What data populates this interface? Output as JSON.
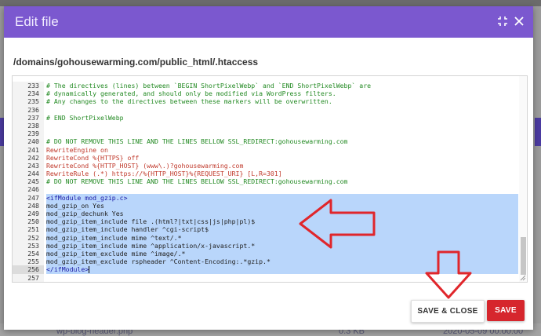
{
  "background": {
    "file_name": "wp-blog-header.php",
    "file_size": "0.3 KB",
    "file_date": "2020-05-09 00:00:00"
  },
  "modal": {
    "title": "Edit file",
    "file_path": "/domains/gohousewarming.com/public_html/.htaccess",
    "icons": [
      "expand-icon",
      "close-icon"
    ]
  },
  "editor": {
    "lines": [
      {
        "num": "233",
        "text": "# The directives (lines) between `BEGIN ShortPixelWebp` and `END ShortPixelWebp` are",
        "style": "comment",
        "selected": false
      },
      {
        "num": "234",
        "text": "# dynamically generated, and should only be modified via WordPress filters.",
        "style": "comment",
        "selected": false
      },
      {
        "num": "235",
        "text": "# Any changes to the directives between these markers will be overwritten.",
        "style": "comment",
        "selected": false
      },
      {
        "num": "236",
        "text": "",
        "style": "plain",
        "selected": false
      },
      {
        "num": "237",
        "text": "# END ShortPixelWebp",
        "style": "comment",
        "selected": false
      },
      {
        "num": "238",
        "text": "",
        "style": "plain",
        "selected": false
      },
      {
        "num": "239",
        "text": "",
        "style": "plain",
        "selected": false
      },
      {
        "num": "240",
        "text": "# DO NOT REMOVE THIS LINE AND THE LINES BELLOW SSL_REDIRECT:gohousewarming.com",
        "style": "comment",
        "selected": false
      },
      {
        "num": "241",
        "text": "RewriteEngine on",
        "style": "directive",
        "selected": false
      },
      {
        "num": "242",
        "text": "RewriteCond %{HTTPS} off",
        "style": "directive",
        "selected": false
      },
      {
        "num": "243",
        "text": "RewriteCond %{HTTP_HOST} (www\\.)?gohousewarming.com",
        "style": "directive",
        "selected": false
      },
      {
        "num": "244",
        "text": "RewriteRule (.*) https://%{HTTP_HOST}%{REQUEST_URI} [L,R=301]",
        "style": "directive",
        "selected": false
      },
      {
        "num": "245",
        "text": "# DO NOT REMOVE THIS LINE AND THE LINES BELLOW SSL_REDIRECT:gohousewarming.com",
        "style": "comment",
        "selected": false
      },
      {
        "num": "246",
        "text": "",
        "style": "plain",
        "selected": false
      },
      {
        "num": "247",
        "text": "<ifModule mod_gzip.c>",
        "style": "tag",
        "selected": true
      },
      {
        "num": "248",
        "text": "mod_gzip_on Yes",
        "style": "plain",
        "selected": true
      },
      {
        "num": "249",
        "text": "mod_gzip_dechunk Yes",
        "style": "plain",
        "selected": true
      },
      {
        "num": "250",
        "text": "mod_gzip_item_include file .(html?|txt|css|js|php|pl)$",
        "style": "plain",
        "selected": true
      },
      {
        "num": "251",
        "text": "mod_gzip_item_include handler ^cgi-script$",
        "style": "plain",
        "selected": true
      },
      {
        "num": "252",
        "text": "mod_gzip_item_include mime ^text/.*",
        "style": "plain",
        "selected": true
      },
      {
        "num": "253",
        "text": "mod_gzip_item_include mime ^application/x-javascript.*",
        "style": "plain",
        "selected": true
      },
      {
        "num": "254",
        "text": "mod_gzip_item_exclude mime ^image/.*",
        "style": "plain",
        "selected": true
      },
      {
        "num": "255",
        "text": "mod_gzip_item_exclude rspheader ^Content-Encoding:.*gzip.*",
        "style": "plain",
        "selected": true
      },
      {
        "num": "256",
        "text": "</ifModule>",
        "style": "tag",
        "selected": true
      },
      {
        "num": "257",
        "text": "",
        "style": "plain",
        "selected": false
      }
    ],
    "active_line": "256"
  },
  "buttons": {
    "save_close": "SAVE & CLOSE",
    "save": "SAVE"
  },
  "colors": {
    "header": "#7b58cf",
    "selection": "#b9d6fb",
    "save_button": "#d6262d",
    "annotation_arrow": "#e0262b"
  }
}
